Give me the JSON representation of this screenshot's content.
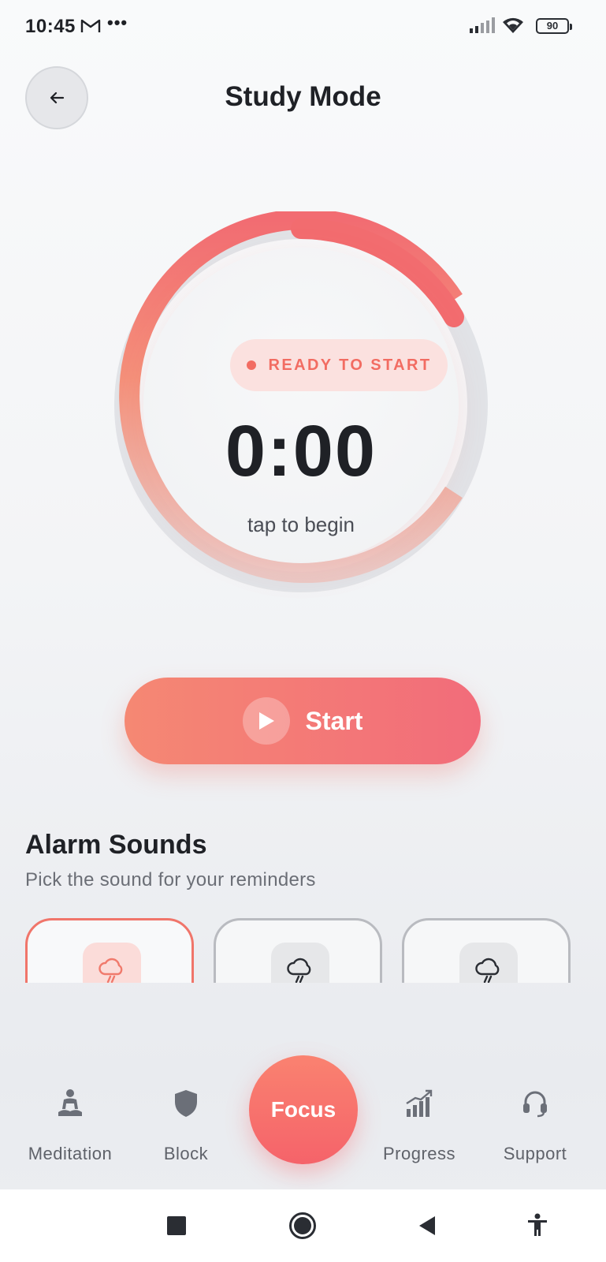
{
  "status_bar": {
    "time": "10:45",
    "more": "•••",
    "battery": "90"
  },
  "header": {
    "title": "Study Mode"
  },
  "timer": {
    "status": "READY TO START",
    "time": "0:00",
    "hint": "tap to begin",
    "progress_fraction": 0.15
  },
  "start_button": {
    "label": "Start"
  },
  "alarm_sounds": {
    "title": "Alarm Sounds",
    "subtitle": "Pick the sound for your reminders",
    "cards": [
      {
        "icon": "rain-cloud-icon",
        "selected": true
      },
      {
        "icon": "rain-cloud-icon",
        "selected": false
      },
      {
        "icon": "rain-cloud-icon",
        "selected": false
      }
    ]
  },
  "bottom_nav": {
    "items": [
      {
        "label": "Meditation",
        "icon": "meditation-icon"
      },
      {
        "label": "Block",
        "icon": "shield-icon"
      },
      {
        "label": "Focus",
        "icon": "focus",
        "active": true
      },
      {
        "label": "Progress",
        "icon": "chart-up-icon"
      },
      {
        "label": "Support",
        "icon": "headset-icon"
      }
    ]
  },
  "colors": {
    "accent": "#f26c62",
    "accent_gradient_start": "#f58873",
    "accent_gradient_end": "#f26c7a",
    "text_primary": "#1f2126",
    "text_secondary": "#6b6e76"
  }
}
